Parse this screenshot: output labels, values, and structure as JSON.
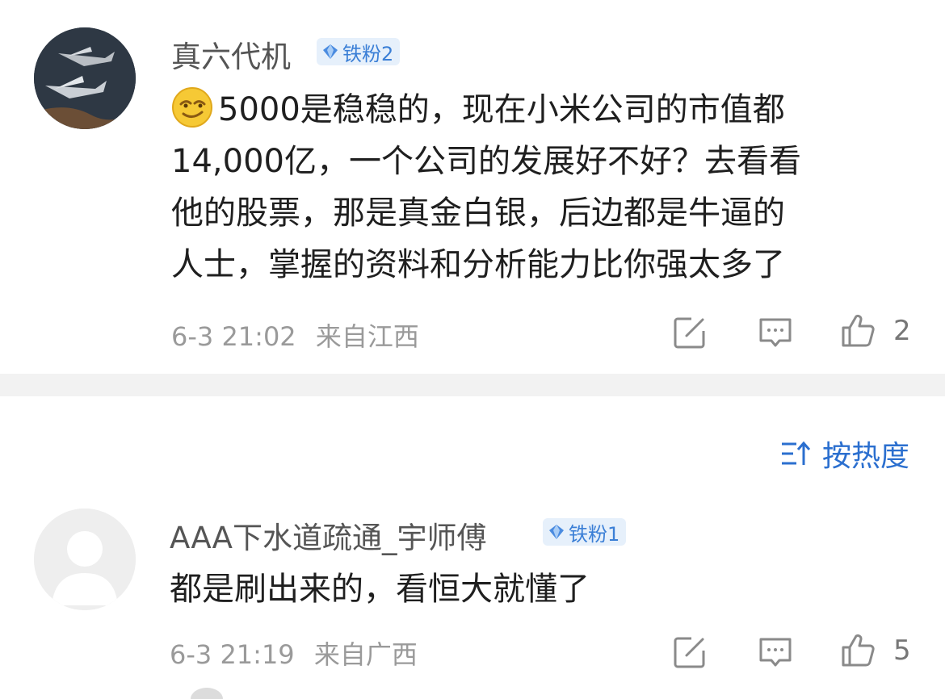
{
  "comments": [
    {
      "username": "真六代机",
      "badge": "铁粉2",
      "text_lines": [
        "5000是稳稳的，现在小米公司的市值都",
        "14,000亿，一个公司的发展好不好？去看看",
        "他的股票，那是真金白银，后边都是牛逼的",
        "人士，掌握的资料和分析能力比你强太多了"
      ],
      "time": "6-3 21:02",
      "location": "来自江西",
      "likes": "2",
      "emoji": "smirk-emoji"
    },
    {
      "username": "AAA下水道疏通_宇师傅",
      "badge": "铁粉1",
      "text_lines": [
        "都是刷出来的，看恒大就懂了"
      ],
      "time": "6-3 21:19",
      "location": "来自广西",
      "likes": "5"
    }
  ],
  "sort": {
    "label": "按热度"
  },
  "colors": {
    "accent": "#2b6fcf",
    "badge_bg": "#e6f0fb",
    "badge_text": "#3b7fd6",
    "meta": "#9a9a9a"
  },
  "icons": [
    "edit-icon",
    "comment-icon",
    "thumbs-up-icon",
    "sort-icon",
    "badge-gem-icon"
  ]
}
